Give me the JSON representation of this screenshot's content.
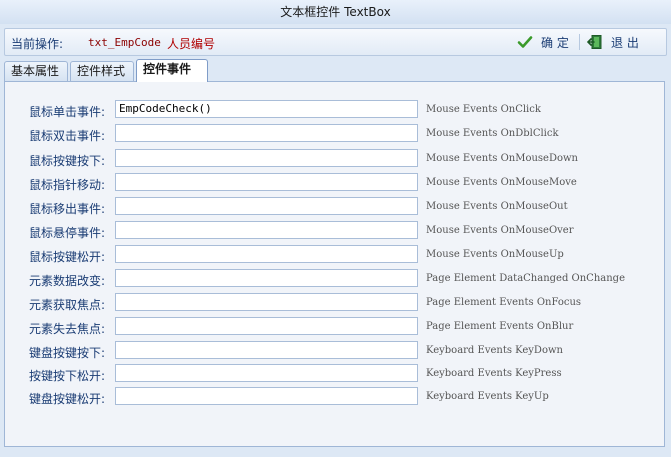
{
  "window": {
    "title": "文本框控件  TextBox"
  },
  "operation": {
    "label": "当前操作:",
    "field": "txt_EmpCode",
    "name": "人员编号",
    "confirm_label": "确 定",
    "exit_label": "退 出"
  },
  "tabs": [
    {
      "label": "基本属性"
    },
    {
      "label": "控件样式"
    },
    {
      "label": "控件事件"
    }
  ],
  "events": [
    {
      "label": "鼠标单击事件:",
      "value": "EmpCodeCheck()",
      "hint": "Mouse Events OnClick"
    },
    {
      "label": "鼠标双击事件:",
      "value": "",
      "hint": "Mouse Events OnDblClick"
    },
    {
      "label": "鼠标按键按下:",
      "value": "",
      "hint": "Mouse Events OnMouseDown"
    },
    {
      "label": "鼠标指针移动:",
      "value": "",
      "hint": "Mouse Events OnMouseMove"
    },
    {
      "label": "鼠标移出事件:",
      "value": "",
      "hint": "Mouse Events OnMouseOut"
    },
    {
      "label": "鼠标悬停事件:",
      "value": "",
      "hint": "Mouse Events OnMouseOver"
    },
    {
      "label": "鼠标按键松开:",
      "value": "",
      "hint": "Mouse Events OnMouseUp"
    },
    {
      "label": "元素数据改变:",
      "value": "",
      "hint": "Page Element DataChanged OnChange"
    },
    {
      "label": "元素获取焦点:",
      "value": "",
      "hint": "Page Element Events OnFocus"
    },
    {
      "label": "元素失去焦点:",
      "value": "",
      "hint": "Page Element Events OnBlur"
    },
    {
      "label": "键盘按键按下:",
      "value": "",
      "hint": "Keyboard Events KeyDown"
    },
    {
      "label": "按键按下松开:",
      "value": "",
      "hint": "Keyboard Events KeyPress"
    },
    {
      "label": "键盘按键松开:",
      "value": "",
      "hint": "Keyboard Events KeyUp"
    }
  ]
}
